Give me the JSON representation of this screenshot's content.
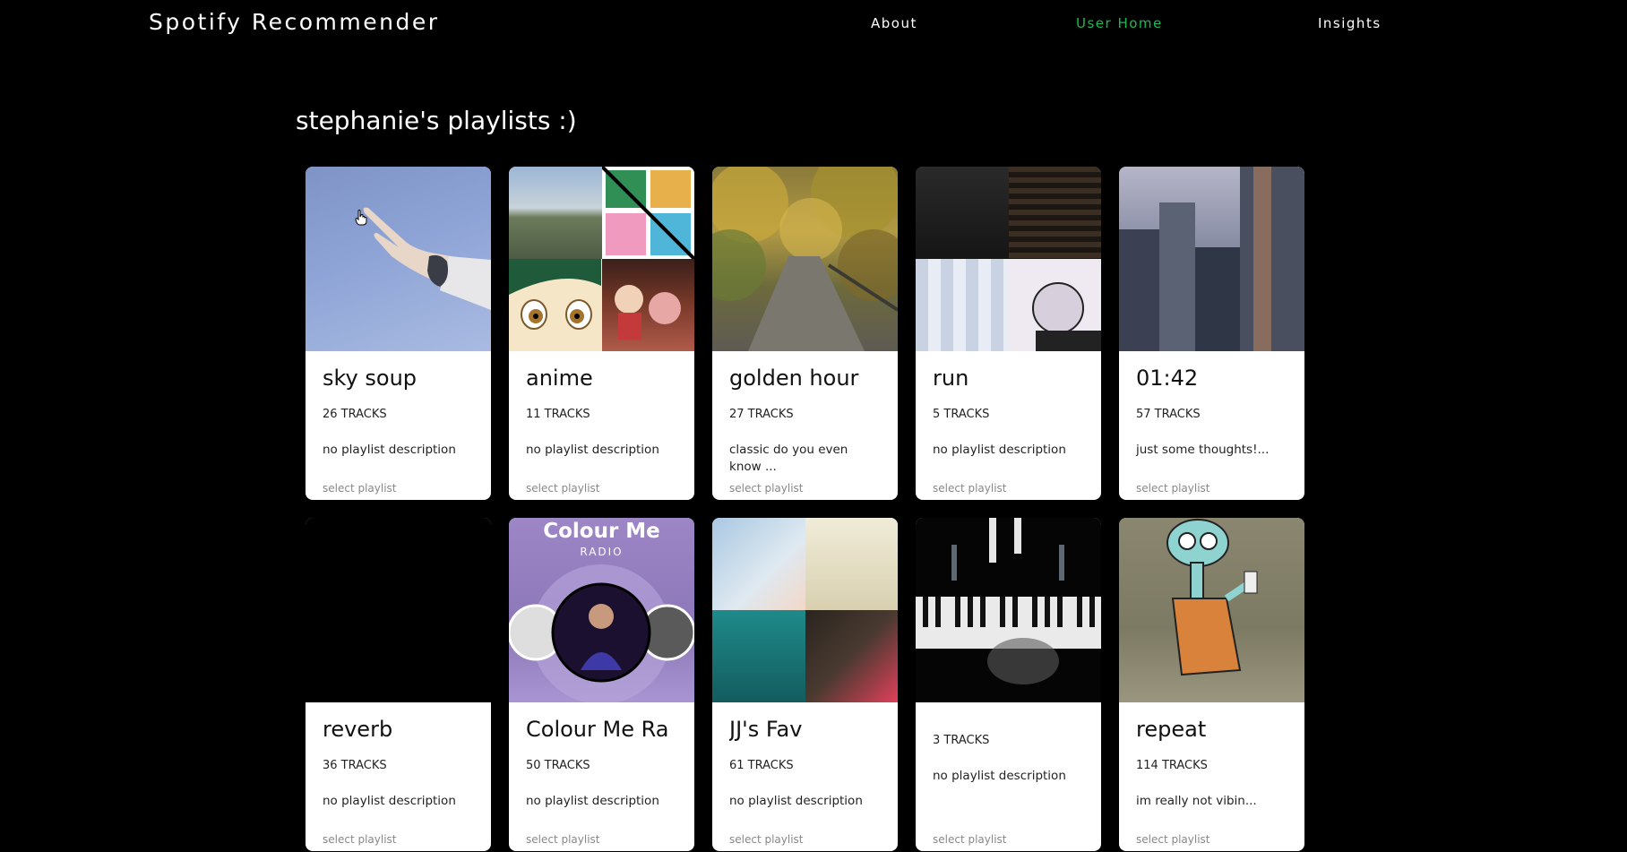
{
  "header": {
    "brand": "Spotify Recommender",
    "nav": [
      {
        "label": "About",
        "active": false
      },
      {
        "label": "User Home",
        "active": true
      },
      {
        "label": "Insights",
        "active": false
      }
    ],
    "accent_color": "#1db954"
  },
  "main": {
    "title": "stephanie's playlists :)",
    "playlists": [
      {
        "name": "sky soup",
        "tracks": "26 TRACKS",
        "description": "no playlist description",
        "action": "select playlist",
        "art": "hand-peace-sign-sky"
      },
      {
        "name": "anime",
        "tracks": "11 TRACKS",
        "description": "no playlist description",
        "action": "select playlist",
        "art": "anime-collage"
      },
      {
        "name": "golden hour",
        "tracks": "27 TRACKS",
        "description": "classic do you even know ...",
        "action": "select playlist",
        "art": "autumn-path"
      },
      {
        "name": "run",
        "tracks": "5 TRACKS",
        "description": "no playlist description",
        "action": "select playlist",
        "art": "album-collage"
      },
      {
        "name": "01:42",
        "tracks": "57 TRACKS",
        "description": "just some thoughts!...",
        "action": "select playlist",
        "art": "city-skyscrapers"
      },
      {
        "name": "reverb",
        "tracks": "36 TRACKS",
        "description": "no playlist description",
        "action": "select playlist",
        "art": "black-cover"
      },
      {
        "name": "Colour Me Ra",
        "tracks": "50 TRACKS",
        "description": "no playlist description",
        "action": "select playlist",
        "art": "colour-me-radio",
        "art_title": "Colour Me",
        "art_subtitle": "RADIO"
      },
      {
        "name": "JJ's Fav",
        "tracks": "61 TRACKS",
        "description": "no playlist description",
        "action": "select playlist",
        "art": "jj-collage"
      },
      {
        "name": "",
        "tracks": "3 TRACKS",
        "description": "no playlist description",
        "action": "select playlist",
        "art": "piano-keys"
      },
      {
        "name": "repeat",
        "tracks": "114 TRACKS",
        "description": "im really not vibin...",
        "action": "select playlist",
        "art": "squidward-cartoon"
      }
    ]
  },
  "icons": {
    "cursor": "hand-pointer-icon"
  }
}
